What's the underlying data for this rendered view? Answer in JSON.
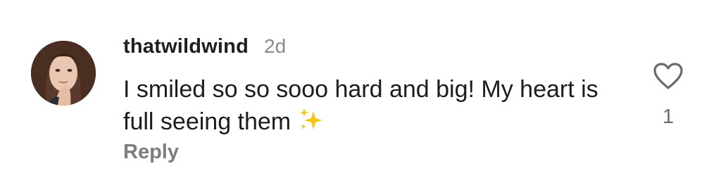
{
  "comment": {
    "username": "thatwildwind",
    "time": "2d",
    "text": "I smiled so so sooo hard and big! My heart is full seeing them",
    "emoji_icon": "sparkles-emoji",
    "reply_label": "Reply",
    "like_count": "1",
    "like_icon": "heart-outline-icon"
  }
}
